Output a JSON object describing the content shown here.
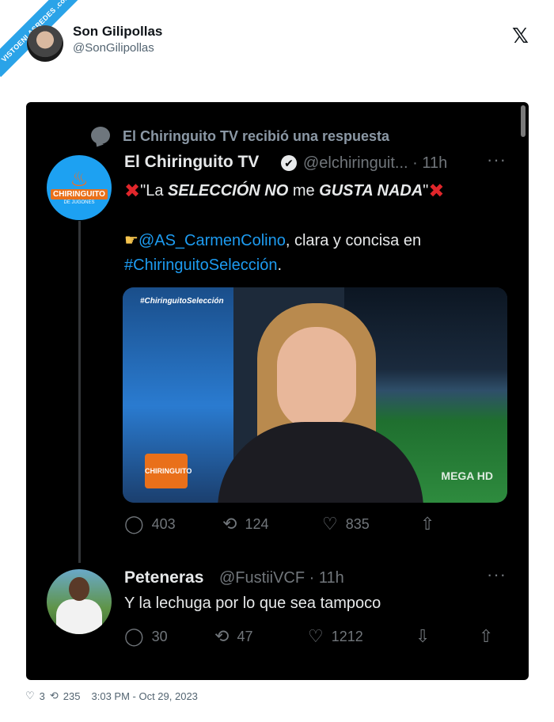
{
  "watermark": "VISTOENLASREDES .com",
  "header": {
    "name": "Son Gilipollas",
    "handle": "@SonGilipollas",
    "x_icon": "x-logo-icon"
  },
  "thread": {
    "replied_label": "El Chiringuito TV recibió una respuesta",
    "tweet": {
      "name": "El Chiringuito TV",
      "verified": "✔",
      "handle_time": "@elchiringuit... · 11h",
      "more": "···",
      "quote_pre": "\"La ",
      "quote_em1": "SELECCIÓN NO",
      "quote_mid": " me ",
      "quote_em2": "GUSTA NADA",
      "quote_post": "\"",
      "mention": "@AS_CarmenColino",
      "body_rest": ", clara y concisa en",
      "hashtag": "#ChiringuitoSelección",
      "period": ".",
      "media": {
        "tag": "#ChiringuitoSelección",
        "logo": "CHIRINGUITO",
        "channel": "MEGA HD"
      },
      "actions": {
        "replies": "403",
        "retweets": "124",
        "likes": "835"
      }
    },
    "reply": {
      "name": "Peteneras",
      "handle_time": "@FustiiVCF · 11h",
      "more": "···",
      "text": "Y la lechuga por lo que sea tampoco",
      "actions": {
        "replies": "30",
        "retweets": "47",
        "likes": "1212"
      }
    }
  },
  "footer": {
    "likes": "3",
    "retweets": "235",
    "timestamp": "3:03 PM - Oct 29, 2023"
  },
  "icons": {
    "reply": "💬",
    "retweet": "⟲",
    "like": "♡",
    "share": "⇪",
    "bookmark": "⇩"
  }
}
